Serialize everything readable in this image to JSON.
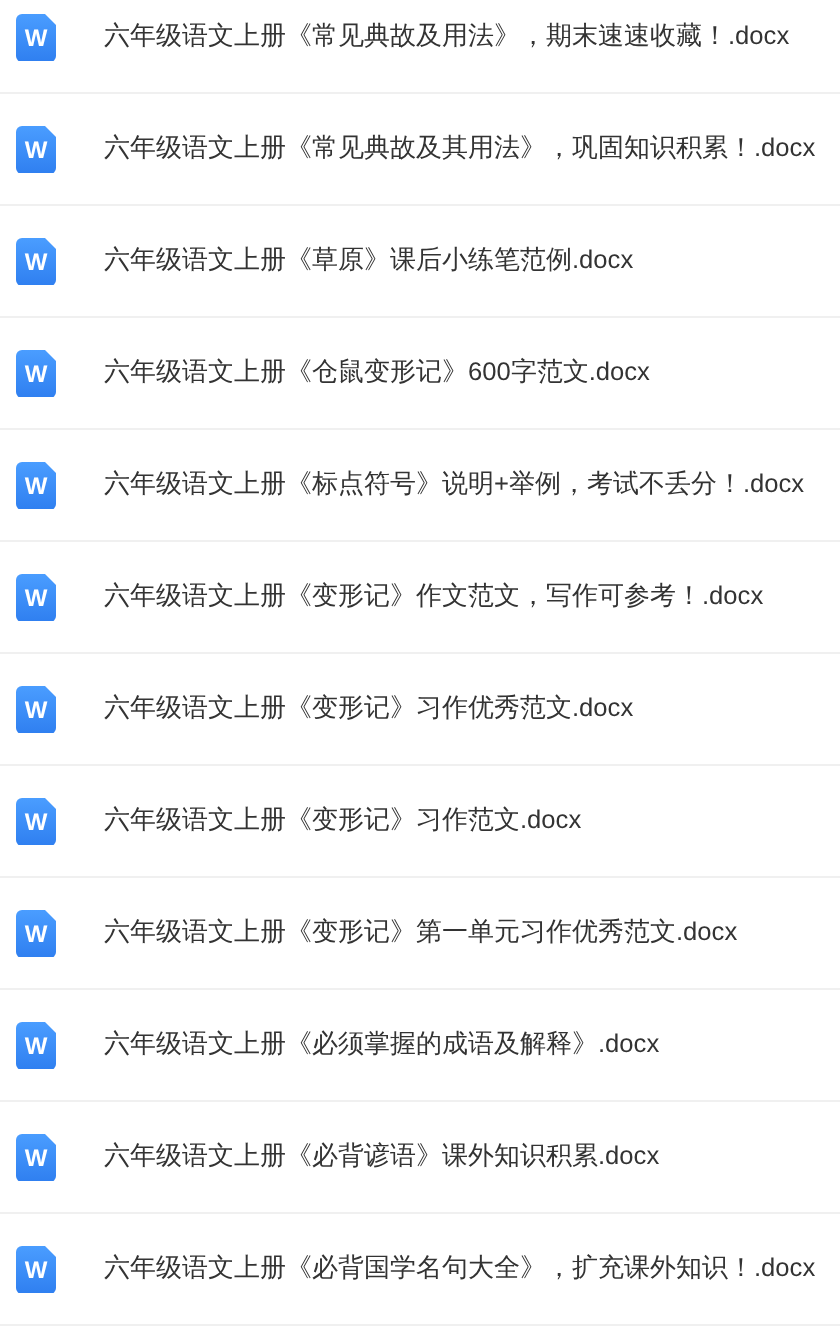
{
  "files": [
    {
      "icon_letter": "W",
      "name": "六年级语文上册《常见典故及用法》，期末速速收藏！.docx"
    },
    {
      "icon_letter": "W",
      "name": "六年级语文上册《常见典故及其用法》，巩固知识积累！.docx"
    },
    {
      "icon_letter": "W",
      "name": "六年级语文上册《草原》课后小练笔范例.docx"
    },
    {
      "icon_letter": "W",
      "name": "六年级语文上册《仓鼠变形记》600字范文.docx"
    },
    {
      "icon_letter": "W",
      "name": "六年级语文上册《标点符号》说明+举例，考试不丢分！.docx"
    },
    {
      "icon_letter": "W",
      "name": "六年级语文上册《变形记》作文范文，写作可参考！.docx"
    },
    {
      "icon_letter": "W",
      "name": "六年级语文上册《变形记》习作优秀范文.docx"
    },
    {
      "icon_letter": "W",
      "name": "六年级语文上册《变形记》习作范文.docx"
    },
    {
      "icon_letter": "W",
      "name": "六年级语文上册《变形记》第一单元习作优秀范文.docx"
    },
    {
      "icon_letter": "W",
      "name": "六年级语文上册《必须掌握的成语及解释》.docx"
    },
    {
      "icon_letter": "W",
      "name": "六年级语文上册《必背谚语》课外知识积累.docx"
    },
    {
      "icon_letter": "W",
      "name": "六年级语文上册《必背国学名句大全》，扩充课外知识！.docx"
    }
  ]
}
